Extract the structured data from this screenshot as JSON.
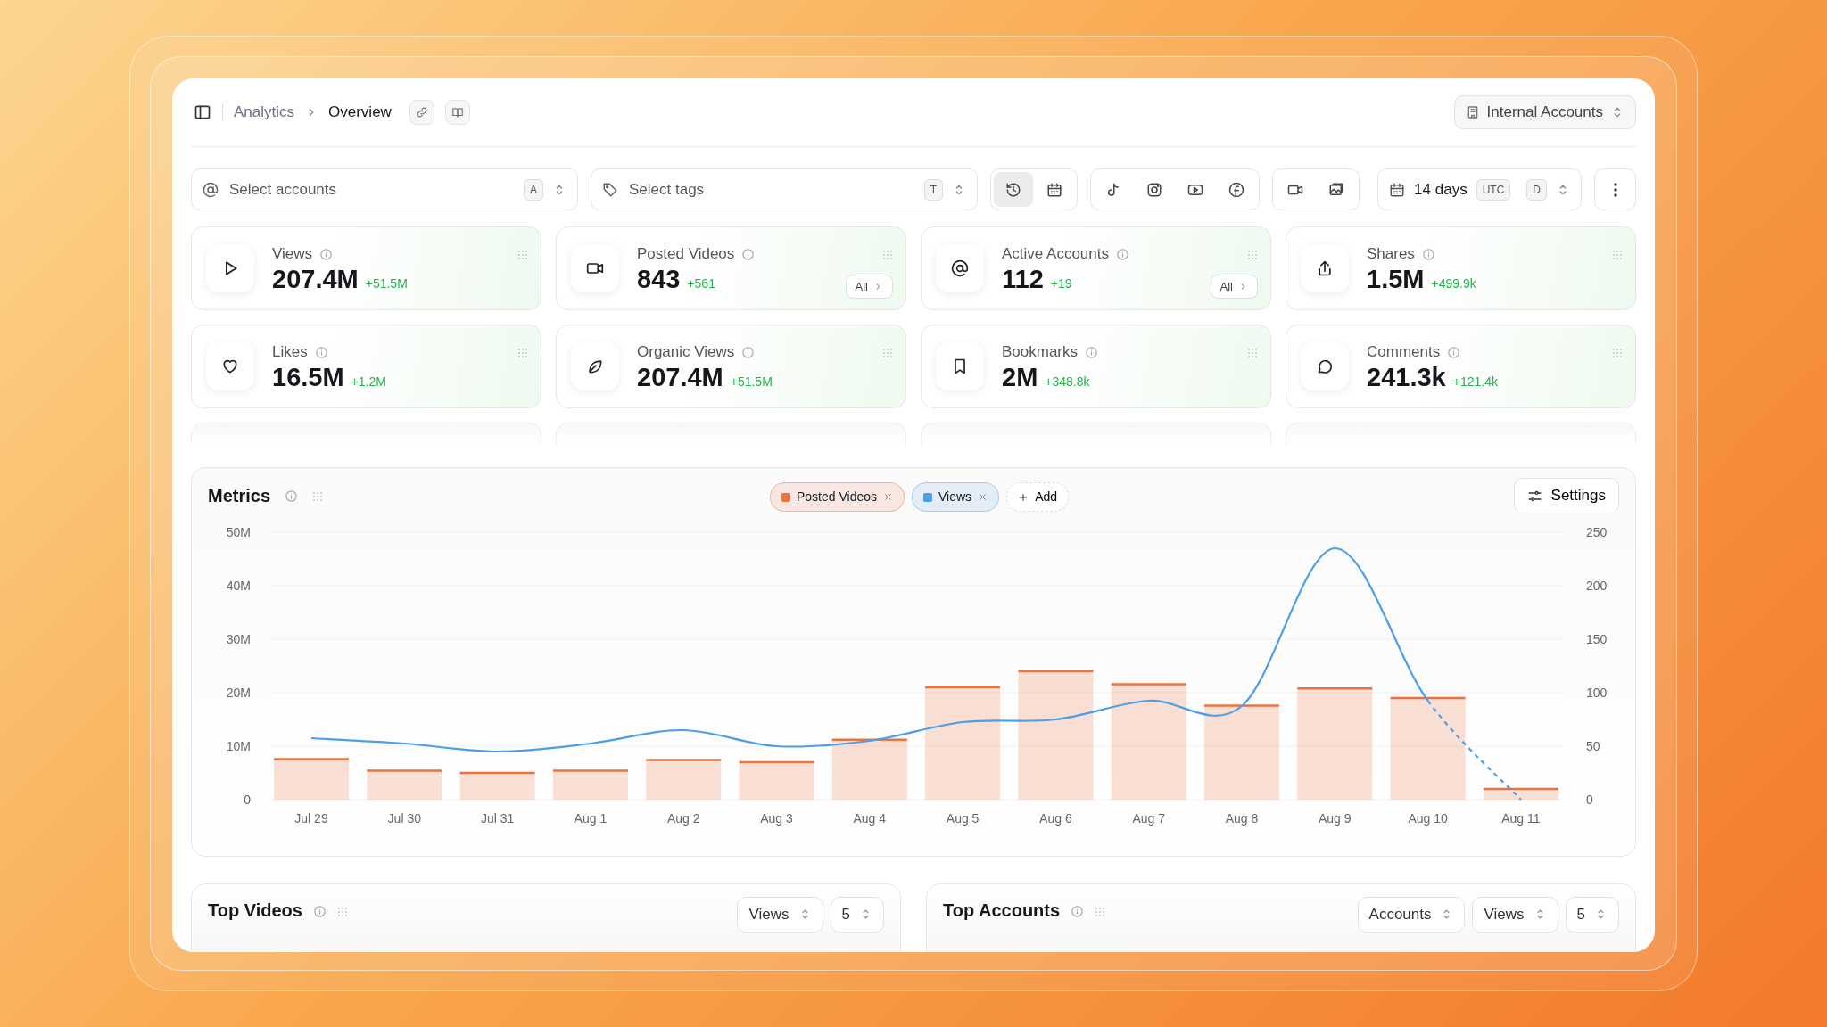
{
  "breadcrumb": {
    "items": [
      "Analytics",
      "Overview"
    ],
    "account_select": "Internal Accounts"
  },
  "filters": {
    "accounts": {
      "placeholder": "Select accounts",
      "shortcut": "A"
    },
    "tags": {
      "placeholder": "Select tags",
      "shortcut": "T"
    },
    "mode_buttons": [
      {
        "selected": true
      },
      {
        "selected": false
      }
    ],
    "range": {
      "label": "14 days",
      "timezone": "UTC",
      "shortcut": "D"
    }
  },
  "metrics": [
    {
      "label": "Views",
      "value": "207.4M",
      "delta": "+51.5M"
    },
    {
      "label": "Posted Videos",
      "value": "843",
      "delta": "+561",
      "button": "All"
    },
    {
      "label": "Active Accounts",
      "value": "112",
      "delta": "+19",
      "button": "All"
    },
    {
      "label": "Shares",
      "value": "1.5M",
      "delta": "+499.9k"
    },
    {
      "label": "Likes",
      "value": "16.5M",
      "delta": "+1.2M"
    },
    {
      "label": "Organic Views",
      "value": "207.4M",
      "delta": "+51.5M"
    },
    {
      "label": "Bookmarks",
      "value": "2M",
      "delta": "+348.8k"
    },
    {
      "label": "Comments",
      "value": "241.3k",
      "delta": "+121.4k"
    }
  ],
  "metrics_chart": {
    "title": "Metrics",
    "add_label": "Add",
    "settings_label": "Settings",
    "chart_data": {
      "type": "bar",
      "categories": [
        "Jul 29",
        "Jul 30",
        "Jul 31",
        "Aug 1",
        "Aug 2",
        "Aug 3",
        "Aug 4",
        "Aug 5",
        "Aug 6",
        "Aug 7",
        "Aug 8",
        "Aug 9",
        "Aug 10",
        "Aug 11"
      ],
      "series": [
        {
          "name": "Posted Videos",
          "color": "#e8743f",
          "axis": "y2",
          "values": [
            38,
            27,
            25,
            27,
            37,
            35,
            56,
            105,
            120,
            108,
            88,
            104,
            95,
            10
          ]
        },
        {
          "name": "Views",
          "color": "#4a9fe8",
          "type": "line",
          "values": [
            11.5,
            10.5,
            9,
            10.5,
            13,
            10,
            11,
            14.5,
            15,
            18.5,
            17.5,
            47,
            18.5,
            0
          ]
        }
      ],
      "grid": true,
      "ylim": [
        0,
        50
      ],
      "y2lim": [
        0,
        250
      ],
      "yticks": [
        {
          "value": 0,
          "label": "0"
        },
        {
          "value": 10,
          "label": "10M"
        },
        {
          "value": 20,
          "label": "20M"
        },
        {
          "value": 30,
          "label": "30M"
        },
        {
          "value": 40,
          "label": "40M"
        },
        {
          "value": 50,
          "label": "50M"
        }
      ],
      "y2ticks": [
        {
          "value": 0,
          "label": "0"
        },
        {
          "value": 50,
          "label": "50"
        },
        {
          "value": 100,
          "label": "100"
        },
        {
          "value": 150,
          "label": "150"
        },
        {
          "value": 200,
          "label": "200"
        },
        {
          "value": 250,
          "label": "250"
        }
      ]
    }
  },
  "bottom_panels": [
    {
      "title": "Top Videos",
      "selects": [
        "Views",
        "5"
      ]
    },
    {
      "title": "Top Accounts",
      "selects": [
        "Accounts",
        "Views",
        "5"
      ]
    }
  ]
}
